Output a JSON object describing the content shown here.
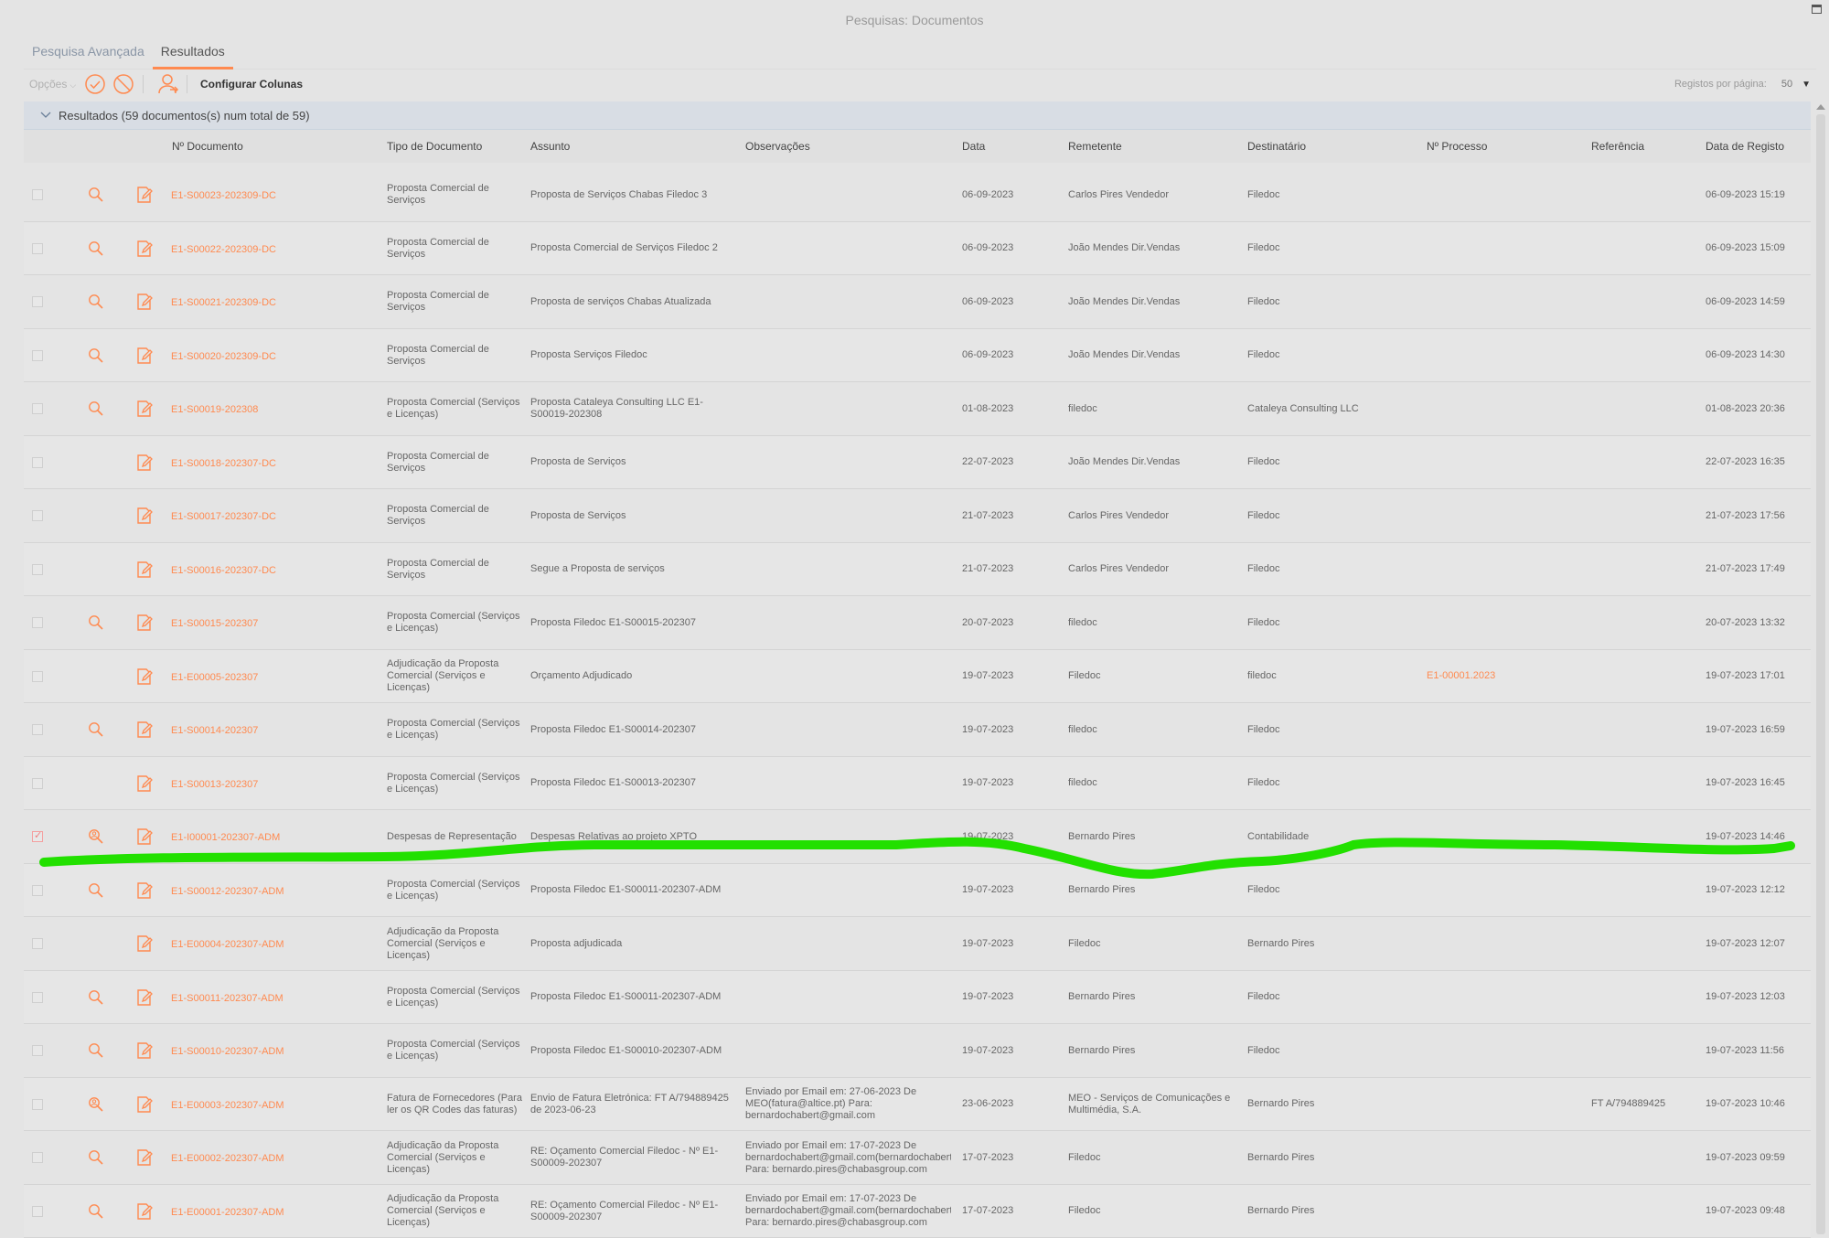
{
  "window": {
    "title": "Pesquisas: Documentos"
  },
  "tabs": [
    {
      "label": "Pesquisa Avançada",
      "active": false
    },
    {
      "label": "Resultados",
      "active": true
    }
  ],
  "toolbar": {
    "options_label": "Opções",
    "configure_columns_label": "Configurar Colunas",
    "per_page_label": "Registos por página:",
    "per_page_value": "50"
  },
  "group": {
    "label": "Resultados (59 documentos(s) num total de 59)"
  },
  "columns": {
    "doc_number": "Nº Documento",
    "doc_type": "Tipo de Documento",
    "subject": "Assunto",
    "notes": "Observações",
    "date": "Data",
    "sender": "Remetente",
    "recipient": "Destinatário",
    "process": "Nº Processo",
    "reference": "Referência",
    "registration_date": "Data de Registo"
  },
  "colors": {
    "accent": "#ff8a50",
    "annotation": "#22e000"
  },
  "rows": [
    {
      "checked": false,
      "search": "search",
      "doc": "E1-S00023-202309-DC",
      "type": "Proposta Comercial de Serviços",
      "subject": "Proposta de Serviços Chabas Filedoc 3",
      "notes": "",
      "date": "06-09-2023",
      "sender": "Carlos Pires Vendedor",
      "recipient": "Filedoc",
      "process": "",
      "reference": "",
      "registered": "06-09-2023 15:19"
    },
    {
      "checked": false,
      "search": "search",
      "doc": "E1-S00022-202309-DC",
      "type": "Proposta Comercial de Serviços",
      "subject": "Proposta Comercial de Serviços Filedoc 2",
      "notes": "",
      "date": "06-09-2023",
      "sender": "João Mendes Dir.Vendas",
      "recipient": "Filedoc",
      "process": "",
      "reference": "",
      "registered": "06-09-2023 15:09"
    },
    {
      "checked": false,
      "search": "search",
      "doc": "E1-S00021-202309-DC",
      "type": "Proposta Comercial de Serviços",
      "subject": "Proposta de serviços Chabas Atualizada",
      "notes": "",
      "date": "06-09-2023",
      "sender": "João Mendes Dir.Vendas",
      "recipient": "Filedoc",
      "process": "",
      "reference": "",
      "registered": "06-09-2023 14:59"
    },
    {
      "checked": false,
      "search": "search",
      "doc": "E1-S00020-202309-DC",
      "type": "Proposta Comercial de Serviços",
      "subject": "Proposta Serviços Filedoc",
      "notes": "",
      "date": "06-09-2023",
      "sender": "João Mendes Dir.Vendas",
      "recipient": "Filedoc",
      "process": "",
      "reference": "",
      "registered": "06-09-2023 14:30"
    },
    {
      "checked": false,
      "search": "search",
      "doc": "E1-S00019-202308",
      "type": "Proposta Comercial (Serviços e Licenças)",
      "subject": "Proposta Cataleya Consulting LLC E1-S00019-202308",
      "notes": "",
      "date": "01-08-2023",
      "sender": "filedoc",
      "recipient": "Cataleya Consulting LLC",
      "process": "",
      "reference": "",
      "registered": "01-08-2023 20:36"
    },
    {
      "checked": false,
      "search": "none",
      "doc": "E1-S00018-202307-DC",
      "type": "Proposta Comercial de Serviços",
      "subject": "Proposta de Serviços",
      "notes": "",
      "date": "22-07-2023",
      "sender": "João Mendes Dir.Vendas",
      "recipient": "Filedoc",
      "process": "",
      "reference": "",
      "registered": "22-07-2023 16:35"
    },
    {
      "checked": false,
      "search": "none",
      "doc": "E1-S00017-202307-DC",
      "type": "Proposta Comercial de Serviços",
      "subject": "Proposta de Serviços",
      "notes": "",
      "date": "21-07-2023",
      "sender": "Carlos Pires Vendedor",
      "recipient": "Filedoc",
      "process": "",
      "reference": "",
      "registered": "21-07-2023 17:56"
    },
    {
      "checked": false,
      "search": "none",
      "doc": "E1-S00016-202307-DC",
      "type": "Proposta Comercial de Serviços",
      "subject": "Segue a Proposta de serviços",
      "notes": "",
      "date": "21-07-2023",
      "sender": "Carlos Pires Vendedor",
      "recipient": "Filedoc",
      "process": "",
      "reference": "",
      "registered": "21-07-2023 17:49"
    },
    {
      "checked": false,
      "search": "search",
      "doc": "E1-S00015-202307",
      "type": "Proposta Comercial (Serviços e Licenças)",
      "subject": "Proposta Filedoc E1-S00015-202307",
      "notes": "",
      "date": "20-07-2023",
      "sender": "filedoc",
      "recipient": "Filedoc",
      "process": "",
      "reference": "",
      "registered": "20-07-2023 13:32"
    },
    {
      "checked": false,
      "search": "none",
      "doc": "E1-E00005-202307",
      "type": "Adjudicação da Proposta Comercial (Serviços e Licenças)",
      "subject": "Orçamento Adjudicado",
      "notes": "",
      "date": "19-07-2023",
      "sender": "Filedoc",
      "recipient": "filedoc",
      "process": "E1-00001.2023",
      "reference": "",
      "registered": "19-07-2023 17:01"
    },
    {
      "checked": false,
      "search": "search",
      "doc": "E1-S00014-202307",
      "type": "Proposta Comercial (Serviços e Licenças)",
      "subject": "Proposta Filedoc E1-S00014-202307",
      "notes": "",
      "date": "19-07-2023",
      "sender": "filedoc",
      "recipient": "Filedoc",
      "process": "",
      "reference": "",
      "registered": "19-07-2023 16:59"
    },
    {
      "checked": false,
      "search": "none",
      "doc": "E1-S00013-202307",
      "type": "Proposta Comercial (Serviços e Licenças)",
      "subject": "Proposta Filedoc E1-S00013-202307",
      "notes": "",
      "date": "19-07-2023",
      "sender": "filedoc",
      "recipient": "Filedoc",
      "process": "",
      "reference": "",
      "registered": "19-07-2023 16:45"
    },
    {
      "checked": true,
      "search": "search-user",
      "doc": "E1-I00001-202307-ADM",
      "type": "Despesas de Representação",
      "subject": "Despesas Relativas ao projeto XPTO",
      "notes": "",
      "date": "19-07-2023",
      "sender": "Bernardo Pires",
      "recipient": "Contabilidade",
      "process": "",
      "reference": "",
      "registered": "19-07-2023 14:46"
    },
    {
      "checked": false,
      "search": "search",
      "doc": "E1-S00012-202307-ADM",
      "type": "Proposta Comercial (Serviços e Licenças)",
      "subject": "Proposta Filedoc E1-S00011-202307-ADM",
      "notes": "",
      "date": "19-07-2023",
      "sender": "Bernardo Pires",
      "recipient": "Filedoc",
      "process": "",
      "reference": "",
      "registered": "19-07-2023 12:12"
    },
    {
      "checked": false,
      "search": "none",
      "doc": "E1-E00004-202307-ADM",
      "type": "Adjudicação da Proposta Comercial (Serviços e Licenças)",
      "subject": "Proposta adjudicada",
      "notes": "",
      "date": "19-07-2023",
      "sender": "Filedoc",
      "recipient": "Bernardo Pires",
      "process": "",
      "reference": "",
      "registered": "19-07-2023 12:07"
    },
    {
      "checked": false,
      "search": "search",
      "doc": "E1-S00011-202307-ADM",
      "type": "Proposta Comercial (Serviços e Licenças)",
      "subject": "Proposta Filedoc E1-S00011-202307-ADM",
      "notes": "",
      "date": "19-07-2023",
      "sender": "Bernardo Pires",
      "recipient": "Filedoc",
      "process": "",
      "reference": "",
      "registered": "19-07-2023 12:03"
    },
    {
      "checked": false,
      "search": "search",
      "doc": "E1-S00010-202307-ADM",
      "type": "Proposta Comercial (Serviços e Licenças)",
      "subject": "Proposta Filedoc E1-S00010-202307-ADM",
      "notes": "",
      "date": "19-07-2023",
      "sender": "Bernardo Pires",
      "recipient": "Filedoc",
      "process": "",
      "reference": "",
      "registered": "19-07-2023 11:56"
    },
    {
      "checked": false,
      "search": "search-user",
      "doc": "E1-E00003-202307-ADM",
      "type": "Fatura de Fornecedores (Para ler os QR Codes das faturas)",
      "subject": "Envio de Fatura Eletrónica: FT A/794889425 de 2023-06-23",
      "notes": "Enviado por Email em: 27-06-2023 De MEO(fatura@altice.pt) Para: bernardochabert@gmail.com",
      "date": "23-06-2023",
      "sender": "MEO - Serviços de Comunicações e Multimédia, S.A.",
      "recipient": "Bernardo Pires",
      "process": "",
      "reference": "FT A/794889425",
      "registered": "19-07-2023 10:46"
    },
    {
      "checked": false,
      "search": "search",
      "doc": "E1-E00002-202307-ADM",
      "type": "Adjudicação da Proposta Comercial (Serviços e Licenças)",
      "subject": "RE: Oçamento Comercial Filedoc - Nº E1-S00009-202307",
      "notes": "Enviado por Email em: 17-07-2023 De bernardochabert@gmail.com(bernardochabert Para: bernardo.pires@chabasgroup.com",
      "date": "17-07-2023",
      "sender": "Filedoc",
      "recipient": "Bernardo Pires",
      "process": "",
      "reference": "",
      "registered": "19-07-2023 09:59"
    },
    {
      "checked": false,
      "search": "search",
      "doc": "E1-E00001-202307-ADM",
      "type": "Adjudicação da Proposta Comercial (Serviços e Licenças)",
      "subject": "RE: Oçamento Comercial Filedoc - Nº E1-S00009-202307",
      "notes": "Enviado por Email em: 17-07-2023 De bernardochabert@gmail.com(bernardochabert Para: bernardo.pires@chabasgroup.com",
      "date": "17-07-2023",
      "sender": "Filedoc",
      "recipient": "Bernardo Pires",
      "process": "",
      "reference": "",
      "registered": "19-07-2023 09:48"
    }
  ]
}
